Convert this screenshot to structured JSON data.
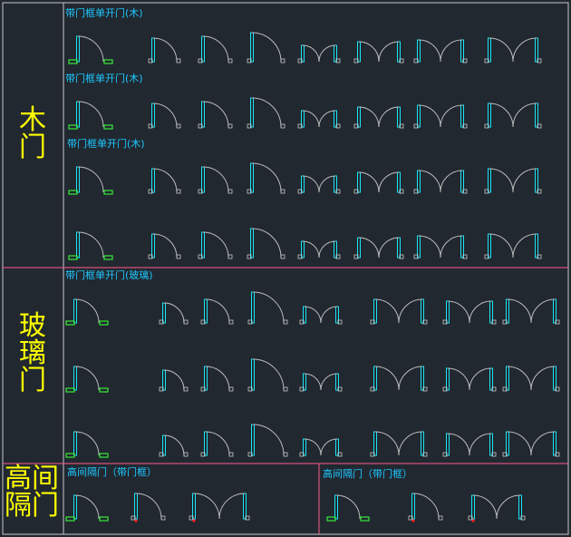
{
  "categories": {
    "wood": "木门",
    "glass": "玻璃门",
    "partition": "高间隔门"
  },
  "titles": {
    "wood_1": "带门框单开门(木)",
    "wood_2": "带门框单开门(木)",
    "wood_3": "带门框单开门(木)",
    "glass_1": "带门框单开门(玻璃)",
    "glass_note": "",
    "partition_left": "高间隔门（带门框）",
    "partition_right": "高间隔门（带门框）"
  },
  "notes": {
    "wood_1": "",
    "wood_2": "",
    "wood_3": "",
    "wood_4": "",
    "glass_1": "",
    "glass_2": "",
    "glass_3": "",
    "partition_left_1": "",
    "partition_left_2": "",
    "partition_left_3": "",
    "partition_right_1": "",
    "partition_right_2": "",
    "partition_right_3": ""
  },
  "palette": {
    "frame_line": "#ff5a8c",
    "grid_line": "#c8c8c8",
    "door_leaf": "#19e6f5",
    "swing_arc": "#bcbcbc",
    "label": "#ffff00",
    "title": "#1ec8ff",
    "handle": "#38e838",
    "hinge_dot": "#ff2020"
  }
}
